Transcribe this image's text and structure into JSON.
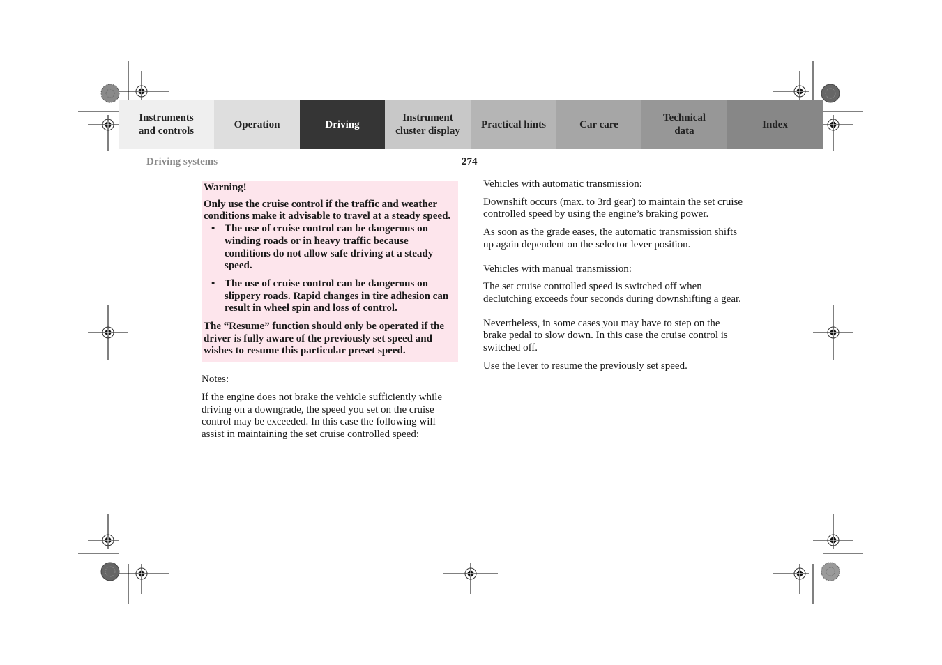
{
  "header": {
    "tabs": [
      {
        "label_line1": "Instruments",
        "label_line2": "and controls",
        "bg": "#efefef",
        "active": false
      },
      {
        "label_line1": "Operation",
        "label_line2": "",
        "bg": "#dedede",
        "active": false
      },
      {
        "label_line1": "Driving",
        "label_line2": "",
        "bg": "#353535",
        "active": true
      },
      {
        "label_line1": "Instrument",
        "label_line2": "cluster display",
        "bg": "#c8c8c8",
        "active": false
      },
      {
        "label_line1": "Practical hints",
        "label_line2": "",
        "bg": "#b5b5b5",
        "active": false
      },
      {
        "label_line1": "Car care",
        "label_line2": "",
        "bg": "#a6a6a6",
        "active": false
      },
      {
        "label_line1": "Technical",
        "label_line2": "data",
        "bg": "#979797",
        "active": false
      },
      {
        "label_line1": "Index",
        "label_line2": "",
        "bg": "#878787",
        "active": false
      }
    ],
    "section_title": "Driving systems",
    "page_number": "274"
  },
  "warning": {
    "heading": "Warning!",
    "intro": "Only use the cruise control if the traffic and weather conditions make it advisable to travel at a steady speed.",
    "bullets": [
      "The use of cruise control can be dangerous on winding roads or in heavy traffic because conditions do not allow safe driving at a steady speed.",
      "The use of cruise control can be dangerous on slippery roads. Rapid changes in tire adhesion can result in wheel spin and loss of control."
    ],
    "bullet_glyph": "•",
    "outro": "The “Resume” function should only be operated if the driver is fully aware of the previously set speed and wishes to resume this particular preset speed.",
    "bg_color": "#fde5ec"
  },
  "left_column": {
    "notes_heading": "Notes:",
    "notes_body": "If the engine does not brake the vehicle sufficiently while driving on a downgrade, the speed you set on the cruise control may be exceeded. In this case the following will assist in maintaining the set cruise controlled speed:"
  },
  "right_column": {
    "auto_heading": "Vehicles with automatic transmission:",
    "auto_p1": "Downshift occurs (max. to 3rd gear) to maintain the set cruise controlled speed by using the engine’s braking power.",
    "auto_p2": "As soon as the grade eases, the automatic transmission shifts up again dependent on the selector lever position.",
    "manual_heading": "Vehicles with manual transmission:",
    "manual_p1": "The set cruise controlled speed is switched off when declutching exceeds four seconds during downshifting a gear.",
    "p_nevertheless": "Nevertheless, in some cases you may have to step on the brake pedal to slow down. In this case the cruise control is switched off.",
    "p_lever": "Use the lever to resume the previously set speed."
  },
  "registration_marks": [
    "crosshair-target-icon",
    "color-wheel-icon"
  ]
}
